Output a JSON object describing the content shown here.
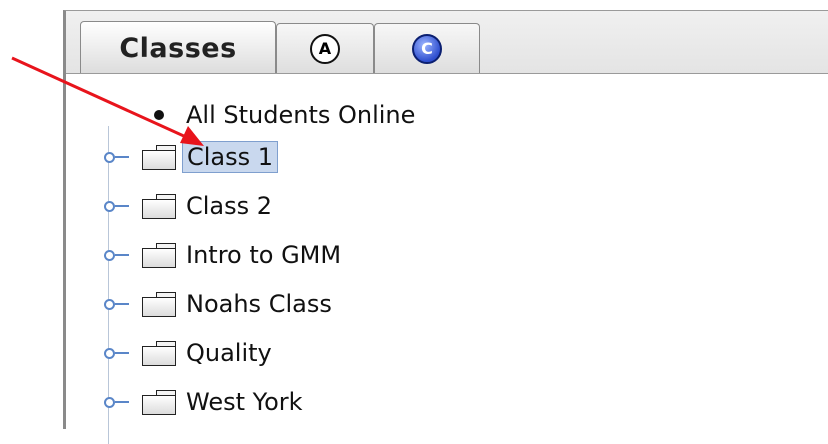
{
  "tabs": [
    {
      "label": "Classes",
      "selected": true
    },
    {
      "icon": "a-circle-icon",
      "glyph": "A"
    },
    {
      "icon": "c-circle-icon",
      "glyph": "C"
    }
  ],
  "tree": {
    "root_label": "All Students Online",
    "items": [
      {
        "label": "Class 1",
        "selected": true
      },
      {
        "label": "Class 2"
      },
      {
        "label": "Intro to GMM"
      },
      {
        "label": "Noahs Class"
      },
      {
        "label": "Quality"
      },
      {
        "label": "West York"
      }
    ]
  },
  "colors": {
    "annotation_arrow": "#e8141c",
    "selection": "#c9d8ee",
    "tree_handle": "#5a86c8",
    "c_icon": "#2f4fcf"
  }
}
